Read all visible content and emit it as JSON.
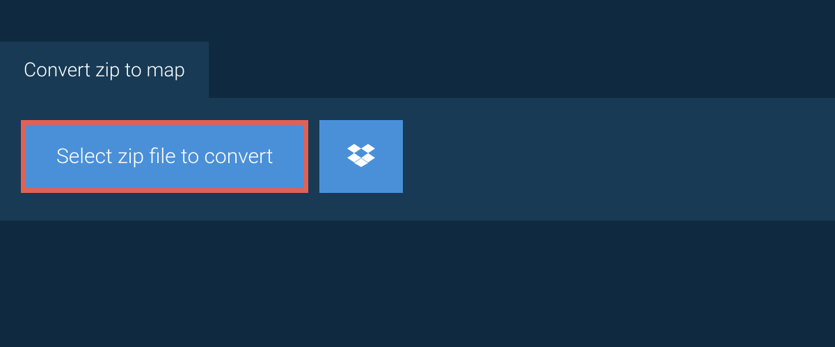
{
  "tab": {
    "title": "Convert zip to map"
  },
  "actions": {
    "select_file_label": "Select zip file to convert"
  }
}
